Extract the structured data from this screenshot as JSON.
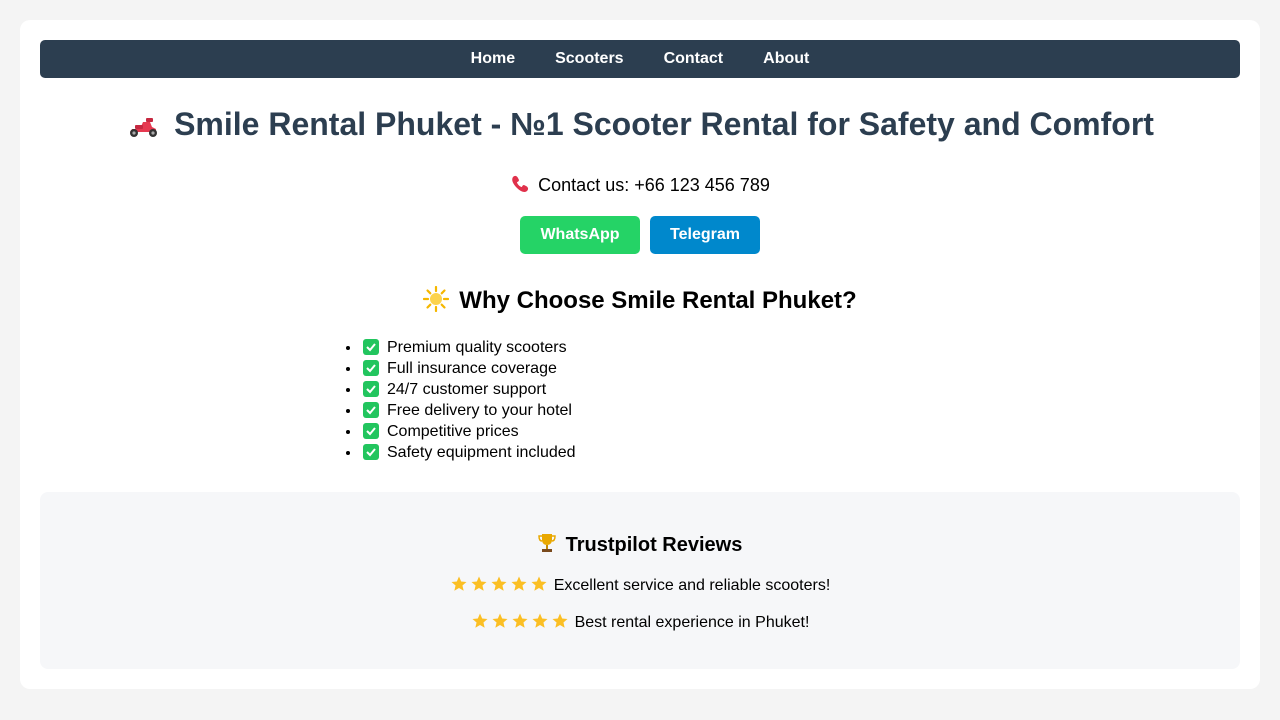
{
  "nav": {
    "items": [
      "Home",
      "Scooters",
      "Contact",
      "About"
    ]
  },
  "hero": {
    "icon": "scooter-icon",
    "title": "Smile Rental Phuket - №1 Scooter Rental for Safety and Comfort"
  },
  "contact": {
    "icon": "phone-icon",
    "text": "Contact us: +66 123 456 789"
  },
  "buttons": {
    "whatsapp_label": "WhatsApp",
    "telegram_label": "Telegram"
  },
  "why": {
    "icon": "sun-icon",
    "heading": "Why Choose Smile Rental Phuket?",
    "features": [
      "Premium quality scooters",
      "Full insurance coverage",
      "24/7 customer support",
      "Free delivery to your hotel",
      "Competitive prices",
      "Safety equipment included"
    ]
  },
  "reviews": {
    "icon": "trophy-icon",
    "heading": "Trustpilot Reviews",
    "items": [
      {
        "rating": 5,
        "text": "Excellent service and reliable scooters!"
      },
      {
        "rating": 5,
        "text": "Best rental experience in Phuket!"
      }
    ]
  },
  "colors": {
    "nav_bg": "#2c3e50",
    "title": "#2c3e50",
    "whatsapp": "#25d366",
    "telegram": "#0088cc",
    "check": "#22c55e",
    "star": "#fbbf24"
  }
}
